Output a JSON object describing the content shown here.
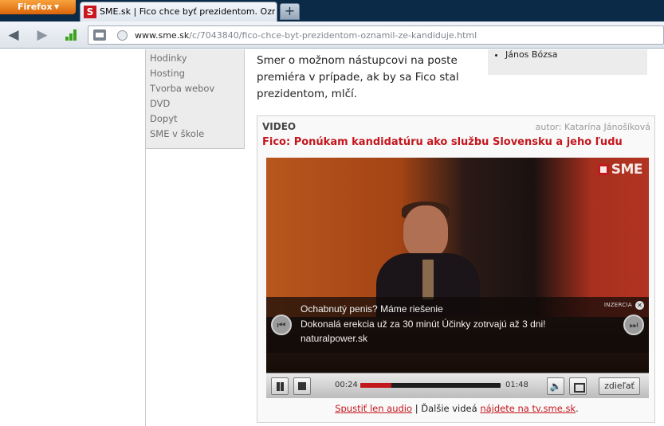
{
  "browser": {
    "app_button_label": "Firefox",
    "tab_title": "SME.sk | Fico chce byť prezidentom. Ozn...",
    "tab_favicon_letter": "S",
    "new_tab_label": "+",
    "url_domain": "www.sme.sk",
    "url_path": "/c/7043840/fico-chce-byt-prezidentom-oznamil-ze-kandiduje.html"
  },
  "left_menu": {
    "items": [
      "Hodinky",
      "Hosting",
      "Tvorba webov",
      "DVD",
      "Dopyt",
      "SME v škole"
    ]
  },
  "article": {
    "text": "Smer o možnom nástupcovi na poste premiéra v prípade, ak by sa Fico stal prezidentom, mlčí."
  },
  "sidebar": {
    "list_item": "János Bózsa"
  },
  "video": {
    "section_label": "VIDEO",
    "author": "autor: Katarína Jánošíková",
    "title": "Fico: Ponúkam kandidatúru ako službu Slovensku a jeho ľudu",
    "logo_text": "SME",
    "ad": {
      "headline": "Ochabnutý penis? Máme riešenie",
      "body": "Dokonalá erekcia už za 30 minút Účinky zotrvajú až 3 dni!",
      "domain": "naturalpower.sk",
      "tag": "INZERCIA"
    },
    "controls": {
      "current_time": "00:24",
      "duration": "01:48",
      "progress_fraction": 0.22,
      "share_label": "zdieľať"
    },
    "footer": {
      "audio_link": "Spustiť len audio",
      "separator": "|",
      "middle_text": "Ďalšie videá",
      "tv_link": "nájdete na tv.sme.sk",
      "end": "."
    }
  },
  "colors": {
    "accent": "#c3171e",
    "firefox_orange": "#e8801d",
    "chrome_dark": "#0b2a47"
  }
}
